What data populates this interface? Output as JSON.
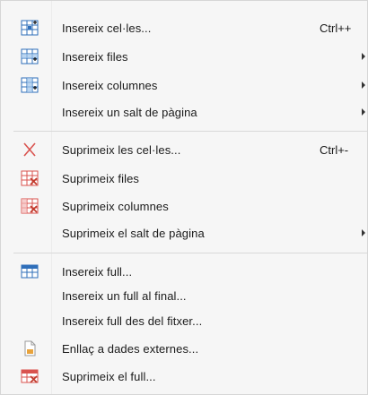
{
  "menu": {
    "items": [
      {
        "label": "Insereix cel·les...",
        "shortcut": "Ctrl++",
        "submenu": false,
        "icon": "insert-cells-icon"
      },
      {
        "label": "Insereix files",
        "shortcut": "",
        "submenu": true,
        "icon": "insert-rows-icon"
      },
      {
        "label": "Insereix columnes",
        "shortcut": "",
        "submenu": true,
        "icon": "insert-columns-icon"
      },
      {
        "label": "Insereix un salt de pàgina",
        "shortcut": "",
        "submenu": true,
        "icon": ""
      },
      {
        "label": "Suprimeix les cel·les...",
        "shortcut": "Ctrl+-",
        "submenu": false,
        "icon": "delete-cells-icon"
      },
      {
        "label": "Suprimeix files",
        "shortcut": "",
        "submenu": false,
        "icon": "delete-rows-icon"
      },
      {
        "label": "Suprimeix columnes",
        "shortcut": "",
        "submenu": false,
        "icon": "delete-columns-icon"
      },
      {
        "label": "Suprimeix el salt de pàgina",
        "shortcut": "",
        "submenu": true,
        "icon": ""
      },
      {
        "label": "Insereix full...",
        "shortcut": "",
        "submenu": false,
        "icon": "insert-sheet-icon"
      },
      {
        "label": "Insereix un full al final...",
        "shortcut": "",
        "submenu": false,
        "icon": ""
      },
      {
        "label": "Insereix full des del fitxer...",
        "shortcut": "",
        "submenu": false,
        "icon": ""
      },
      {
        "label": "Enllaç a dades externes...",
        "shortcut": "",
        "submenu": false,
        "icon": "external-data-icon"
      },
      {
        "label": "Suprimeix el full...",
        "shortcut": "",
        "submenu": false,
        "icon": "delete-sheet-icon"
      }
    ]
  },
  "colors": {
    "grid_blue": "#2f6fba",
    "delete_red": "#d9534f",
    "doc_orange": "#e8a33c"
  }
}
